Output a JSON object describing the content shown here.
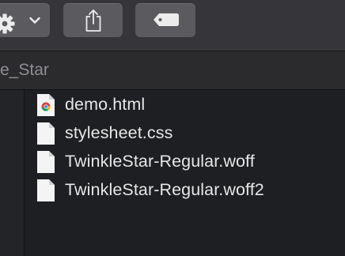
{
  "toolbar": {
    "action_icon": "gear-icon",
    "action_menu_icon": "chevron-down-icon",
    "share_icon": "share-icon",
    "tags_icon": "tag-icon"
  },
  "pathbar": {
    "current_folder": "e_Star"
  },
  "files": [
    {
      "name": "demo.html",
      "icon": "chrome-document-icon"
    },
    {
      "name": "stylesheet.css",
      "icon": "document-icon"
    },
    {
      "name": "TwinkleStar-Regular.woff",
      "icon": "document-icon"
    },
    {
      "name": "TwinkleStar-Regular.woff2",
      "icon": "document-icon"
    }
  ],
  "colors": {
    "background": "#1f2023",
    "toolbar": "#36363a",
    "button": "#5b5b5f",
    "text": "#e6e6e6",
    "muted_text": "#8e8e93"
  }
}
